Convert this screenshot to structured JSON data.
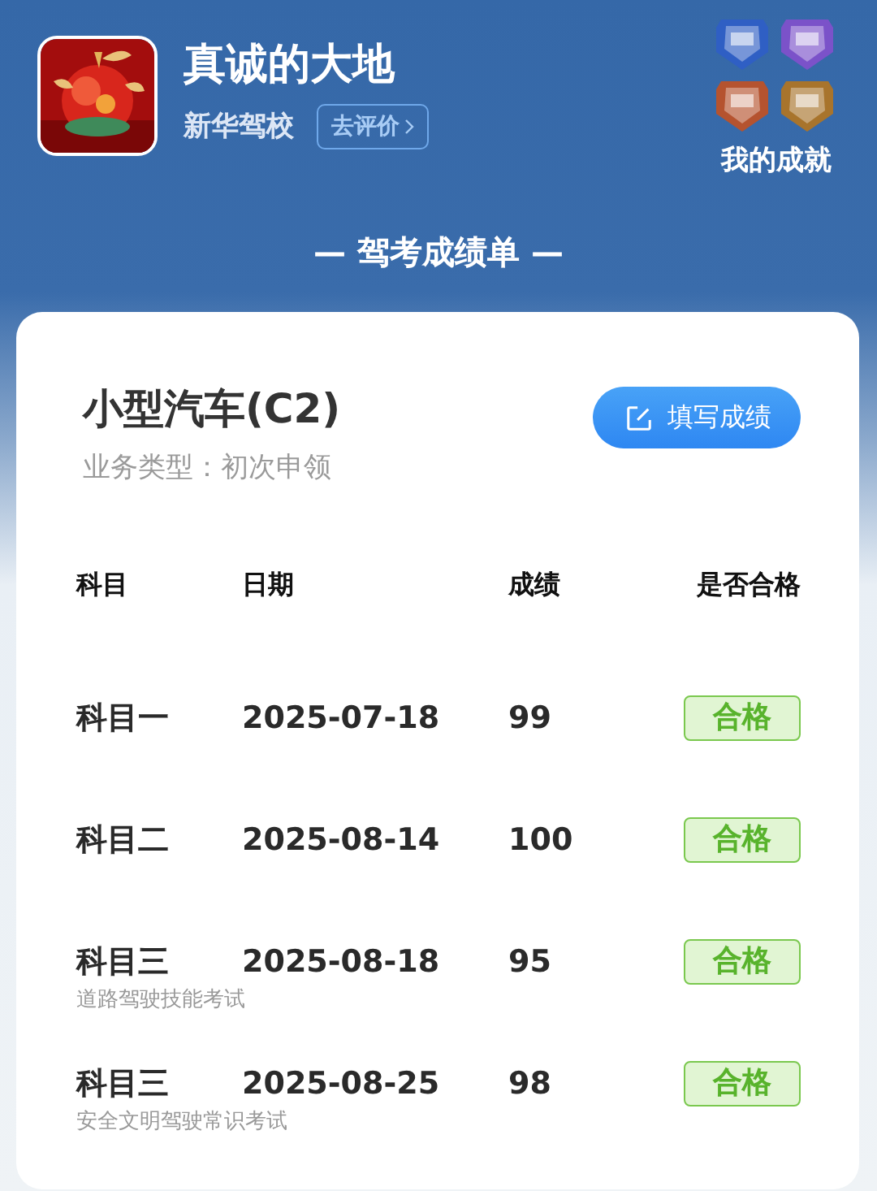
{
  "profile": {
    "name": "真诚的大地",
    "school": "新华驾校",
    "review_button": "去评价"
  },
  "achievements": {
    "badges": [
      {
        "color": "#2f5fc4"
      },
      {
        "color": "#7b52c9"
      },
      {
        "color": "#b5532f"
      },
      {
        "color": "#a8742c"
      }
    ],
    "label": "我的成就"
  },
  "section_title": "— 驾考成绩单 —",
  "card": {
    "title": "小型汽车(C2)",
    "subtitle": "业务类型：初次申领",
    "fill_button": "填写成绩",
    "columns": [
      "科目",
      "日期",
      "成绩",
      "是否合格"
    ],
    "rows": [
      {
        "subject": "科目一",
        "date": "2025-07-18",
        "score": "99",
        "result": "合格"
      },
      {
        "subject": "科目二",
        "date": "2025-08-14",
        "score": "100",
        "result": "合格"
      },
      {
        "subject": "科目三",
        "note": "道路驾驶技能考试",
        "date": "2025-08-18",
        "score": "95",
        "result": "合格"
      },
      {
        "subject": "科目三",
        "note": "安全文明驾驶常识考试",
        "date": "2025-08-25",
        "score": "98",
        "result": "合格"
      }
    ]
  }
}
